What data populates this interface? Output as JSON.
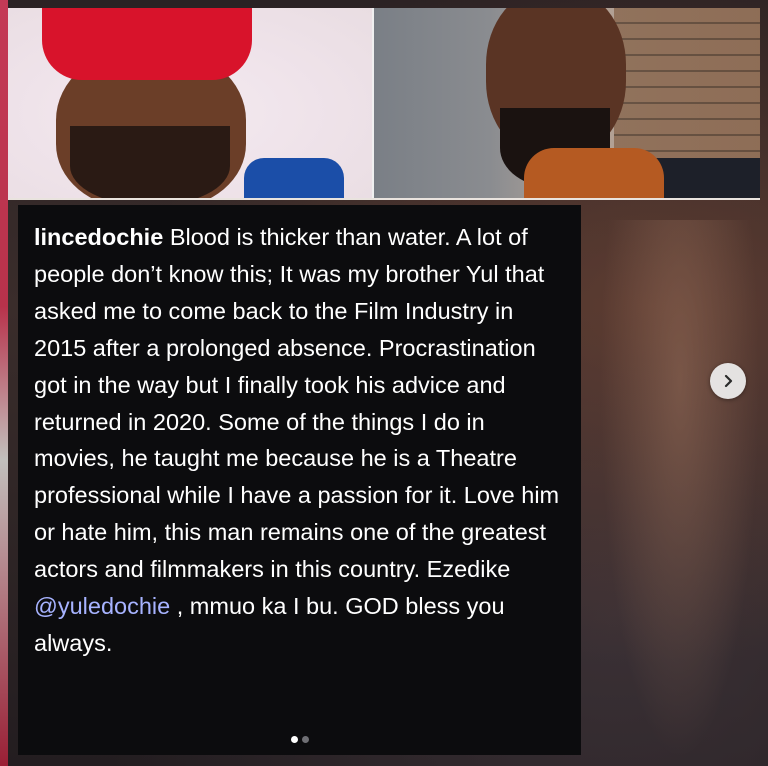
{
  "post": {
    "username": "lincedochie",
    "caption_part1": " Blood is thicker than water. A lot of people don’t know this; It was my brother Yul that asked me to come back to the Film Industry in 2015 after a prolonged absence. Procrastination got in the way but I finally took his advice and returned in 2020. Some of the things I do in movies, he taught me because he is a Theatre professional while I have a passion for it. Love him or hate him, this man remains one of the greatest actors and filmmakers in this country. Ezedike ",
    "mention": "@yuledochie",
    "caption_part2": " , mmuo ka I bu. GOD bless you always."
  },
  "carousel": {
    "current_index": 1,
    "total": 2,
    "next_icon": "chevron-right-icon"
  },
  "colors": {
    "caption_bg": "#0c0c0e",
    "mention": "#a7b3ff",
    "cap_red": "#d8132b"
  }
}
